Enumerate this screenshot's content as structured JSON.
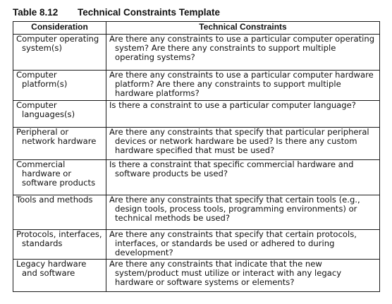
{
  "table": {
    "number": "Table 8.12",
    "title": "Technical Constraints Template",
    "headers": [
      "Consideration",
      "Technical Constraints"
    ],
    "rows": [
      {
        "consideration": "Computer operating system(s)",
        "constraint": "Are there any constraints to use a particular computer operating system? Are there any constraints to support multiple operating systems?"
      },
      {
        "consideration": "Computer platform(s)",
        "constraint": "Are there any constraints to use a particular computer hardware platform? Are there any constraints to support multiple hardware platforms?"
      },
      {
        "consideration": "Computer languages(s)",
        "constraint": "Is there a constraint to use a particular computer language?"
      },
      {
        "consideration": "Peripheral or network hardware",
        "constraint": "Are there any constraints that specify that particular peripheral devices or network hardware be used? Is there any custom hardware specified that must be used?"
      },
      {
        "consideration": "Commercial hardware or software products",
        "constraint": "Is there a constraint that specific commercial hardware and software products be used?"
      },
      {
        "consideration": "Tools and methods",
        "constraint": "Are there any constraints that specify that certain tools (e.g., design tools, process tools, programming environments) or technical methods be used?"
      },
      {
        "consideration": "Protocols, interfaces, standards",
        "constraint": "Are there any constraints that specify that certain protocols, interfaces, or standards be used or adhered to during development?"
      },
      {
        "consideration": "Legacy hardware and software",
        "constraint": "Are there any constraints that indicate that the new system/product must utilize or interact with any legacy hardware or software systems or elements?"
      }
    ]
  }
}
